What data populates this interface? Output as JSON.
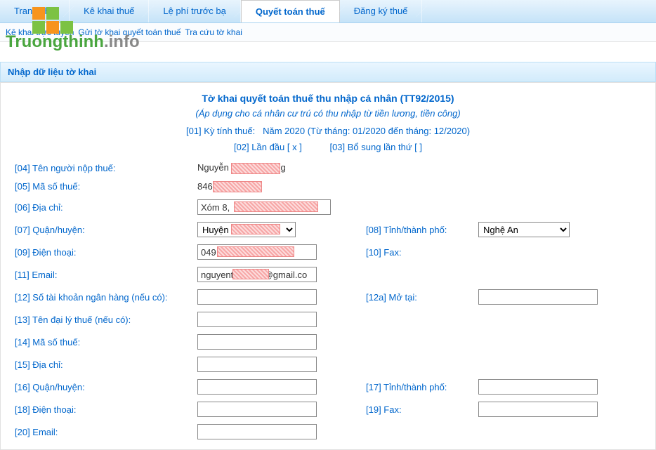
{
  "tabs": [
    {
      "label": "Trang chủ"
    },
    {
      "label": "Kê khai thuế"
    },
    {
      "label": "Lệ phí trước bạ"
    },
    {
      "label": "Quyết toán thuế",
      "active": true
    },
    {
      "label": "Đăng ký thuế"
    }
  ],
  "submenu": [
    "Kê khai trực tuyến",
    "Gửi tờ khai quyết toán thuế",
    "Tra cứu tờ khai"
  ],
  "section_header": "Nhập dữ liệu tờ khai",
  "form_title": "Tờ khai quyết toán thuế thu nhập cá nhân (TT92/2015)",
  "form_subtitle": "(Áp dụng cho cá nhân cư trú có thu nhập từ tiền lương, tiền công)",
  "period_label": "[01] Kỳ tính thuế:",
  "period_value": "Năm 2020 (Từ tháng: 01/2020 đến tháng: 12/2020)",
  "check_first_time": "[02] Lần đầu  [ x ]",
  "check_supplement": "[03] Bổ sung lần thứ   [  ]",
  "fields": {
    "f04_label": "[04] Tên người nộp thuế:",
    "f04_val_prefix": "Nguyễn",
    "f04_val_suffix": "g",
    "f05_label": "[05] Mã số thuế:",
    "f05_val_prefix": "846",
    "f06_label": "[06] Địa chỉ:",
    "f06_val_prefix": "Xóm 8, ",
    "f07_label": "[07] Quận/huyện:",
    "f07_val_prefix": "Huyện ",
    "f08_label": "[08] Tỉnh/thành phố:",
    "f08_val": "Nghệ An",
    "f09_label": "[09] Điện thoại:",
    "f09_val_prefix": "049",
    "f10_label": "[10] Fax:",
    "f11_label": "[11] Email:",
    "f11_val_prefix": "nguyent",
    "f11_val_suffix": "@gmail.co",
    "f12_label": "[12] Số tài khoản ngân hàng (nếu có):",
    "f12a_label": "[12a] Mở tại:",
    "f13_label": "[13] Tên đại lý thuế (nếu có):",
    "f14_label": "[14] Mã số thuế:",
    "f15_label": "[15] Địa chỉ:",
    "f16_label": "[16] Quận/huyện:",
    "f17_label": "[17] Tỉnh/thành phố:",
    "f18_label": "[18] Điện thoại:",
    "f19_label": "[19] Fax:",
    "f20_label": "[20] Email:"
  },
  "watermark": {
    "text_green": "Truongthinh",
    "text_gray": ".info"
  }
}
